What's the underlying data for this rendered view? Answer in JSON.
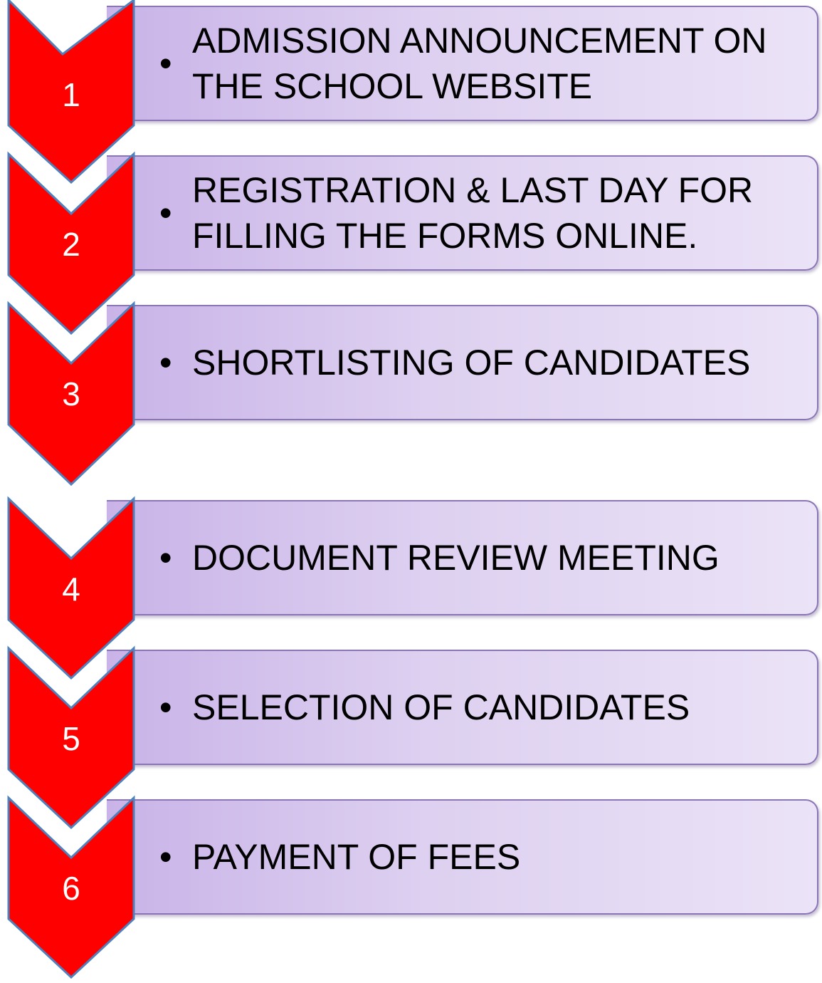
{
  "steps": [
    {
      "number": "1",
      "bullet": "•",
      "text": "ADMISSION ANNOUNCEMENT ON THE SCHOOL WEBSITE"
    },
    {
      "number": "2",
      "bullet": "•",
      "text": "REGISTRATION & LAST DAY FOR FILLING THE FORMS ONLINE."
    },
    {
      "number": "3",
      "bullet": "•",
      "text": "SHORTLISTING OF CANDIDATES"
    },
    {
      "number": "4",
      "bullet": "•",
      "text": "DOCUMENT REVIEW MEETING"
    },
    {
      "number": "5",
      "bullet": "•",
      "text": "SELECTION OF CANDIDATES"
    },
    {
      "number": "6",
      "bullet": "•",
      "text": "PAYMENT OF FEES"
    }
  ],
  "colors": {
    "chevron_fill": "#ff0000",
    "chevron_stroke": "#4f81bd",
    "box_start": "#c9b3e8",
    "box_end": "#ebe3f7",
    "box_border": "#8a75b5"
  }
}
